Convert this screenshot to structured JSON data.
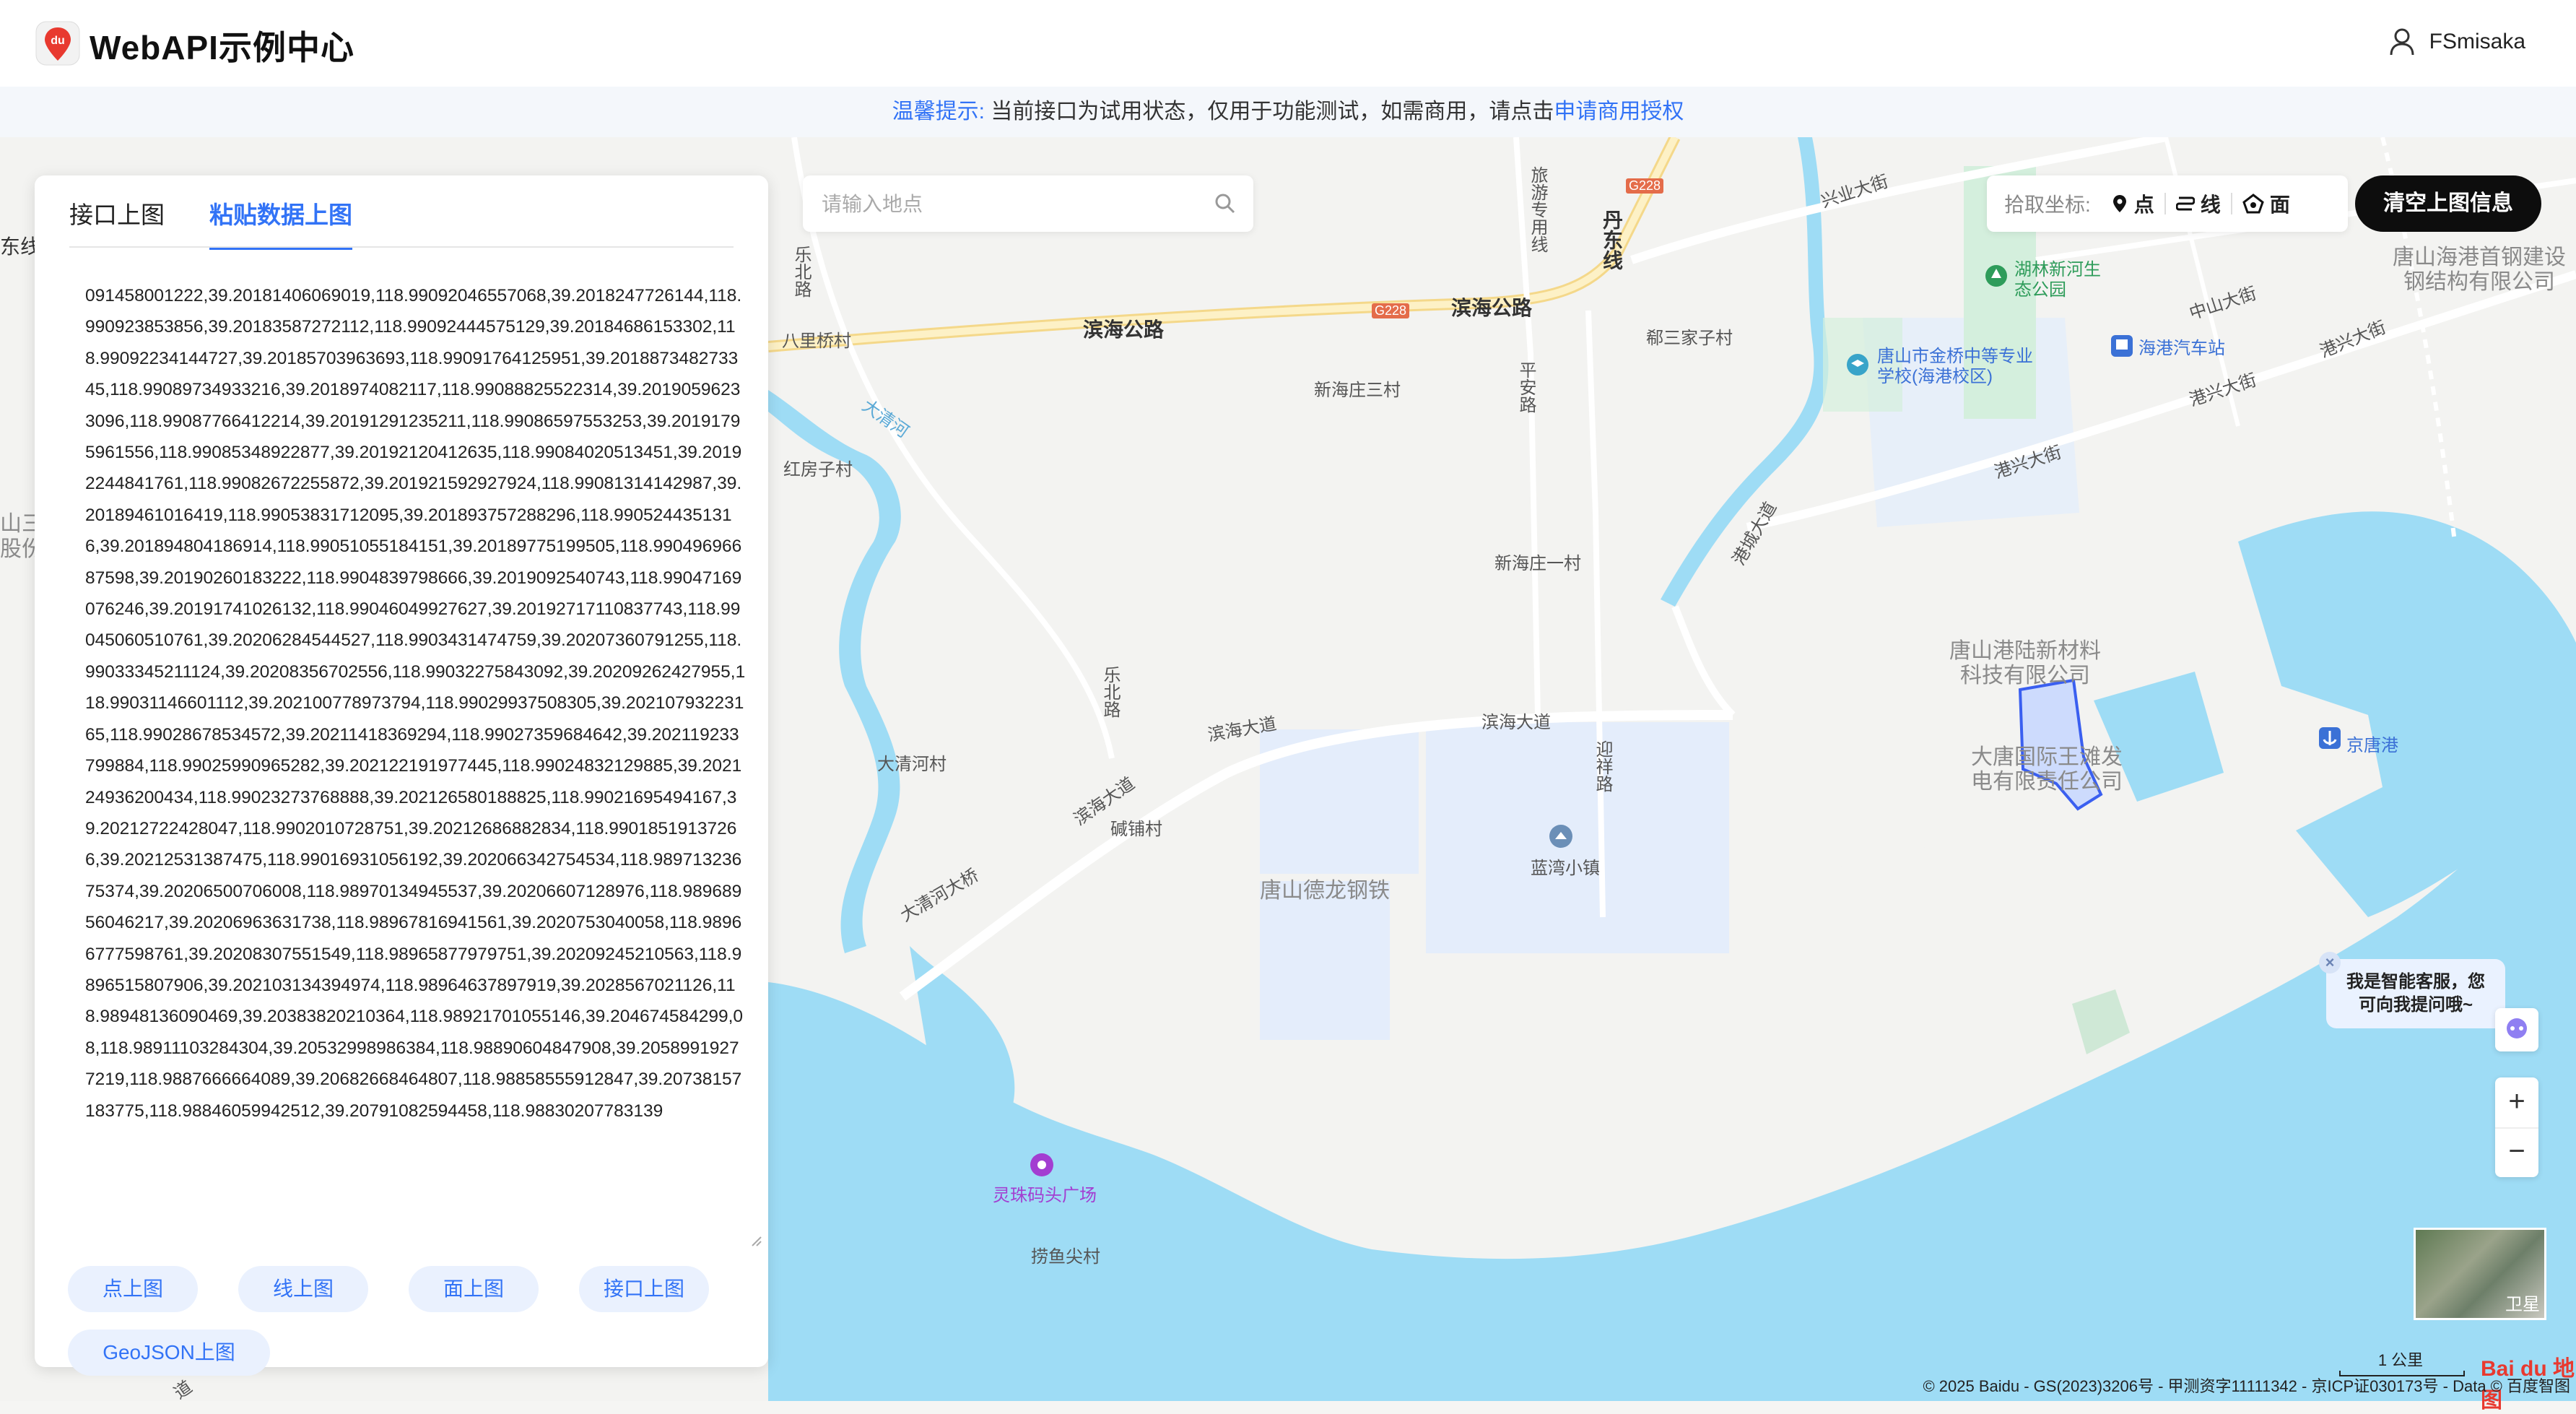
{
  "header": {
    "brand": "WebAPI示例中心",
    "user_name": "FSmisaka",
    "logo_text": "du"
  },
  "notice": {
    "prefix": "温馨提示:",
    "text": " 当前接口为试用状态，仅用于功能测试，如需商用，请点击",
    "link": "申请商用授权"
  },
  "panel": {
    "tabs": [
      {
        "label": "接口上图",
        "active": false
      },
      {
        "label": "粘贴数据上图",
        "active": true
      }
    ],
    "textarea_value": "091458001222,39.20181406069019,118.99092046557068,39.2018247726144,118.990923853856,39.20183587272112,118.99092444575129,39.20184686153302,118.99092234144727,39.20185703963693,118.99091764125951,39.201887348273345,118.99089734933216,39.2018974082117,118.99088825522314,39.20190596233096,118.99087766412214,39.20191291235211,118.99086597553253,39.20191795961556,118.99085348922877,39.20192120412635,118.99084020513451,39.20192244841761,118.99082672255872,39.201921592927924,118.99081314142987,39.20189461016419,118.99053831712095,39.201893757288296,118.9905244351316,39.201894804186914,118.99051055184151,39.20189775199505,118.99049696687598,39.20190260183222,118.9904839798666,39.2019092540743,118.99047169076246,39.20191741026132,118.99046049927627,39.20192717110837743,118.99045060510761,39.20206284544527,118.9903431474759,39.20207360791255,118.99033345211124,39.20208356702556,118.99032275843092,39.20209262427955,118.99031146601112,39.202100778973794,118.99029937508305,39.20210793223165,118.99028678534572,39.20211418369294,118.99027359684642,39.202119233799884,118.99025990965282,39.202122191977445,118.99024832129885,39.202124936200434,118.99023273768888,39.202126580188825,118.99021695494167,39.20212722428047,118.9902010728751,39.20212686882834,118.99018519137266,39.20212531387475,118.99016931056192,39.202066342754534,118.98971323675374,39.20206500706008,118.98970134945537,39.20206607128976,118.98968956046217,39.20206963631738,118.98967816941561,39.2020753040058,118.98966777598761,39.20208307551549,118.98965877979751,39.20209245210563,118.9896515807906,39.202103134394974,118.98964637897919,39.2028567021126,118.98948136090469,39.20383820210364,118.98921701055146,39.204674584299,08,118.98911103284304,39.20532998986384,118.98890604847908,39.20589919277219,118.9887666664089,39.20682668464807,118.98858555912847,39.20738157183775,118.98846059942512,39.20791082594458,118.98830207783139",
    "buttons_row1": [
      "点上图",
      "线上图",
      "面上图",
      "接口上图"
    ],
    "buttons_row2": [
      "GeoJSON上图"
    ]
  },
  "search": {
    "placeholder": "请输入地点"
  },
  "pick": {
    "label": "拾取坐标:",
    "point": "点",
    "line": "线",
    "polygon": "面"
  },
  "clear_button": "清空上图信息",
  "chat": {
    "line1": "我是智能客服，您",
    "line2": "可向我提问哦~",
    "close": "×"
  },
  "zoom": {
    "in": "+",
    "out": "−"
  },
  "satellite_label": "卫星",
  "scale_label": "1 公里",
  "copyright": "© 2025 Baidu - GS(2023)3206号 - 甲测资字11111342 - 京ICP证030173号 - Data © 百度智图",
  "baidu_logo": "Bai du 地图",
  "map_labels": {
    "dongxian": "东线",
    "shan_san": "山三",
    "gufen": "股份有",
    "babaqiao": "八里桥村",
    "binhai_road_1": "滨海公路",
    "binhai_road_2": "滨海公路",
    "g228_a": "G228",
    "g228_b": "G228",
    "lvyou": "旅游专用线",
    "danxian": "丹东线",
    "xingye": "兴业大街",
    "lebei_1": "乐北路",
    "lebei_2": "乐北路",
    "daqinghe": "大清河",
    "hongfangzi": "红房子村",
    "xinhaizhuang3": "新海庄三村",
    "pingan": "平安路",
    "haotun": "郗三家子村",
    "school": "唐山市金桥中等专业学校(海港校区)",
    "park": "湖林新河生态公园",
    "zhongshan": "中山大街",
    "gangxing_1": "港兴大街",
    "gangxing_2": "港兴大街",
    "gangxing_3": "港兴大街",
    "bus": "海港汽车站",
    "steel_co": "唐山海港首钢建设钢结构有限公司",
    "xinhaizhuang1": "新海庄一村",
    "binhai_1": "滨海大道",
    "binhai_2": "滨海大道",
    "binhai_3": "滨海大道",
    "gangcheng": "港城大道",
    "newmat": "唐山港陆新材料科技有限公司",
    "datang": "大唐国际王滩发电有限责任公司",
    "jingtang": "京唐港",
    "daqinghe_cun": "大清河村",
    "jianpu": "碱铺村",
    "daqinghe_bridge": "大清河大桥",
    "yingxiang": "迎祥路",
    "delong": "唐山德龙钢铁",
    "lanwan": "蓝湾小镇",
    "lingzhu": "灵珠码头广场",
    "laoyu": "捞鱼尖村",
    "daodao": "道"
  }
}
